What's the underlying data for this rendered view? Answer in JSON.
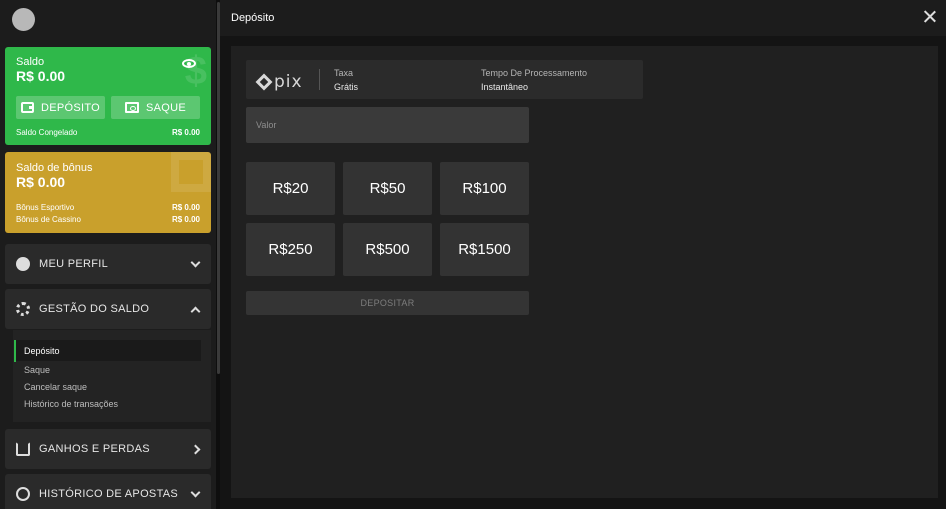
{
  "header": {
    "title": "Depósito"
  },
  "balance_card": {
    "label": "Saldo",
    "amount": "R$ 0.00",
    "deposit_label": "DEPÓSITO",
    "withdraw_label": "SAQUE",
    "frozen_label": "Saldo Congelado",
    "frozen_value": "R$ 0.00",
    "color": "#2fb84a"
  },
  "bonus_card": {
    "label": "Saldo de bônus",
    "amount": "R$ 0.00",
    "sport_label": "Bônus Esportivo",
    "sport_value": "R$ 0.00",
    "casino_label": "Bônus de Cassino",
    "casino_value": "R$ 0.00",
    "color": "#c9a02c"
  },
  "menu": {
    "profile": "MEU PERFIL",
    "balance_mgmt": "GESTÃO DO SALDO",
    "gains_losses": "GANHOS E PERDAS",
    "bet_history": "HISTÓRICO DE APOSTAS"
  },
  "submenu": [
    "Depósito",
    "Saque",
    "Cancelar saque",
    "Histórico de transações"
  ],
  "method": {
    "logo_text": "pix",
    "fee_label": "Taxa",
    "fee_value": "Grátis",
    "time_label": "Tempo De Processamento",
    "time_value": "Instantâneo"
  },
  "amount_input": {
    "placeholder": "Valor",
    "value": ""
  },
  "quick_amounts": [
    "R$20",
    "R$50",
    "R$100",
    "R$250",
    "R$500",
    "R$1500"
  ],
  "submit_label": "DEPOSITAR"
}
